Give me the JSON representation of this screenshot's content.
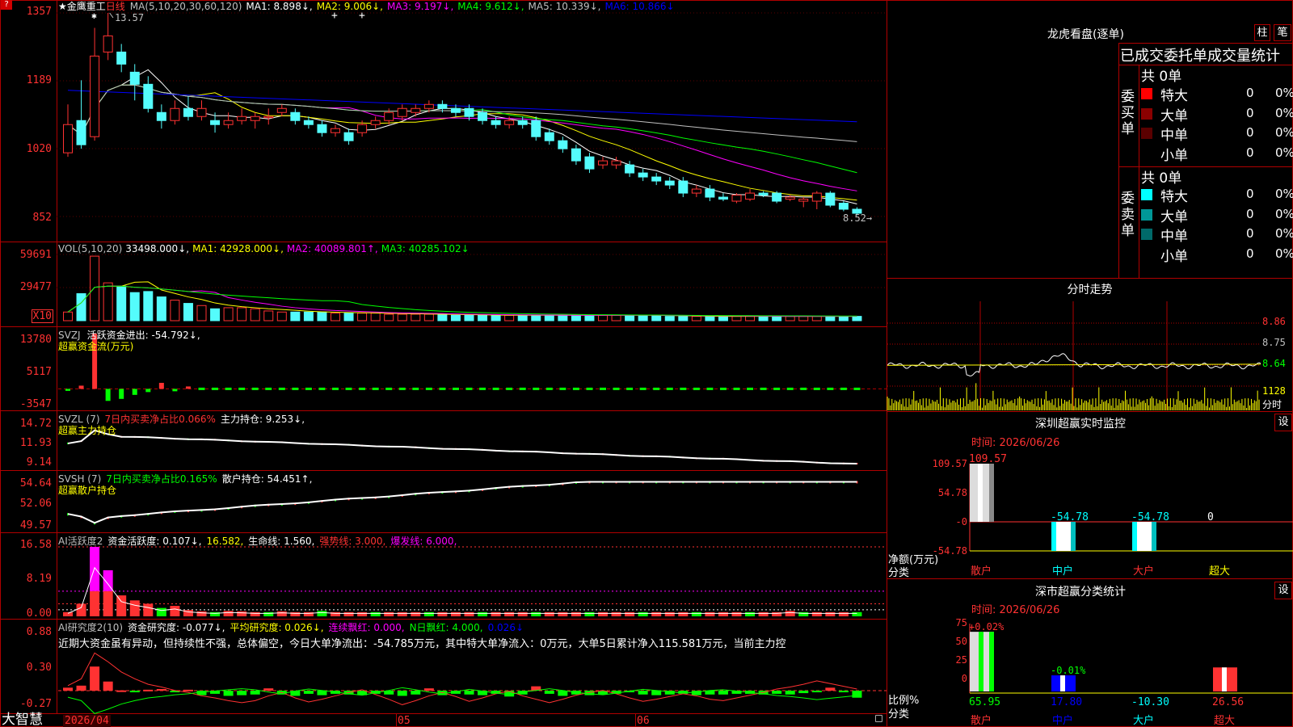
{
  "app": {
    "brand": "大智慧",
    "stock_name": "金鹰重工",
    "period": "日线",
    "marker": "★"
  },
  "colors": {
    "up": "#ff3232",
    "down": "#54fcfc",
    "vol": "#ffff54",
    "grid": "#b00000",
    "bg": "#000000"
  },
  "price_panel": {
    "ma_header": [
      {
        "text": "MA(5,10,20,30,60,120)",
        "color": "#c0c0c0"
      },
      {
        "text": "MA1: 8.898↓,",
        "color": "#ffffff"
      },
      {
        "text": "MA2: 9.006↓,",
        "color": "#ffff00"
      },
      {
        "text": "MA3: 9.197↓,",
        "color": "#ff00ff"
      },
      {
        "text": "MA4: 9.612↓,",
        "color": "#00ff00"
      },
      {
        "text": "MA5: 10.339↓,",
        "color": "#c0c0c0"
      },
      {
        "text": "MA6: 10.866↓",
        "color": "#0000ff"
      }
    ],
    "y_ticks": [
      "1357",
      "1189",
      "1020",
      "852"
    ],
    "high_label": "13.57",
    "low_label": "8.52"
  },
  "vol_panel": {
    "header": [
      {
        "text": "VOL(5,10,20)",
        "color": "#c0c0c0"
      },
      {
        "text": "33498.000↓,",
        "color": "#ffffff"
      },
      {
        "text": "MA1: 42928.000↓,",
        "color": "#ffff00"
      },
      {
        "text": "MA2: 40089.801↑,",
        "color": "#ff00ff"
      },
      {
        "text": "MA3: 40285.102↓",
        "color": "#00ff00"
      }
    ],
    "y_ticks": [
      "59691",
      "29477"
    ],
    "unit": "X10"
  },
  "svzj_panel": {
    "header": [
      {
        "text": "SVZJ",
        "color": "#c0c0c0"
      },
      {
        "text": "活跃资金进出: -54.792↓,",
        "color": "#ffffff"
      }
    ],
    "title": "超赢资金流(万元)",
    "y_ticks": [
      "13780",
      "5117",
      "-3547"
    ]
  },
  "svzl_panel": {
    "header": [
      {
        "text": "SVZL (7)",
        "color": "#c0c0c0"
      },
      {
        "text": "7日内买卖净占比0.066%",
        "color": "#ff3232"
      },
      {
        "text": "主力持仓: 9.253↓,",
        "color": "#ffffff"
      }
    ],
    "title": "超赢主力持仓",
    "y_ticks": [
      "14.72",
      "11.93",
      "9.14"
    ]
  },
  "svsh_panel": {
    "header": [
      {
        "text": "SVSH (7)",
        "color": "#c0c0c0"
      },
      {
        "text": "7日内买卖净占比0.165%",
        "color": "#00ff00"
      },
      {
        "text": "散户持仓: 54.451↑,",
        "color": "#ffffff"
      }
    ],
    "title": "超赢散户持仓",
    "y_ticks": [
      "54.64",
      "52.06",
      "49.57"
    ]
  },
  "ai_panel": {
    "header": [
      {
        "text": "AI活跃度2",
        "color": "#c0c0c0"
      },
      {
        "text": "资金活跃度: 0.107↓,",
        "color": "#ffffff"
      },
      {
        "text": "16.582,",
        "color": "#ffff00"
      },
      {
        "text": "生命线: 1.560,",
        "color": "#ffffff"
      },
      {
        "text": "强势线: 3.000,",
        "color": "#ff3232"
      },
      {
        "text": "爆发线: 6.000,",
        "color": "#ff00ff"
      }
    ],
    "y_ticks": [
      "16.58",
      "8.19",
      "0.00"
    ]
  },
  "air_panel": {
    "header": [
      {
        "text": "AI研究度2(10)",
        "color": "#c0c0c0"
      },
      {
        "text": "资金研究度: -0.077↓,",
        "color": "#ffffff"
      },
      {
        "text": "平均研究度: 0.026↓,",
        "color": "#ffff00"
      },
      {
        "text": "连续飘红: 0.000,",
        "color": "#ff00ff"
      },
      {
        "text": "N日飘红: 4.000,",
        "color": "#00ff00"
      },
      {
        "text": "0.026↓",
        "color": "#0000ff"
      }
    ],
    "comment": "近期大资金虽有异动，但持续性不强，总体偏空，今日大单净流出：-54.785万元，其中特大单净流入：0万元，大单5日累计净入115.581万元，当前主力控",
    "y_ticks": [
      "0.88",
      "0.30",
      "-0.27"
    ]
  },
  "x_axis": {
    "labels": [
      "2026/04",
      "05",
      "06"
    ]
  },
  "longhu": {
    "title": "龙虎看盘(逐单)",
    "btn_zhu": "柱",
    "btn_bi": "笔",
    "stats_title": "已成交委托单成交量统计",
    "buy": {
      "side": "委买单",
      "total": "共 0单",
      "rows": [
        {
          "label": "特大",
          "count": "0",
          "pct": "0%",
          "color": "#ff0000"
        },
        {
          "label": "大单",
          "count": "0",
          "pct": "0%",
          "color": "#8b0000"
        },
        {
          "label": "中单",
          "count": "0",
          "pct": "0%",
          "color": "#5a0000"
        },
        {
          "label": "小单",
          "count": "0",
          "pct": "0%",
          "color": ""
        }
      ]
    },
    "sell": {
      "side": "委卖单",
      "total": "共 0单",
      "rows": [
        {
          "label": "特大",
          "count": "0",
          "pct": "0%",
          "color": "#00ffff"
        },
        {
          "label": "大单",
          "count": "0",
          "pct": "0%",
          "color": "#009898"
        },
        {
          "label": "中单",
          "count": "0",
          "pct": "0%",
          "color": "#006a6a"
        },
        {
          "label": "小单",
          "count": "0",
          "pct": "0%",
          "color": ""
        }
      ]
    }
  },
  "intraday": {
    "title": "分时走势",
    "price_ticks": [
      "8.86",
      "8.75",
      "8.64"
    ],
    "vol_tick": "1128",
    "vol_label": "分时"
  },
  "sz_monitor": {
    "title": "深圳超赢实时监控",
    "settings": "设",
    "time": "时间: 2026/06/26",
    "y_ticks": [
      "109.57",
      "54.78",
      "-0",
      "-54.78"
    ],
    "axis_label_1": "净额(万元)",
    "axis_label_2": "分类"
  },
  "sz_class": {
    "title": "深市超赢分类统计",
    "settings": "设",
    "time": "时间: 2026/06/26",
    "y_ticks": [
      "75",
      "50",
      "25",
      "0"
    ],
    "axis_label_1": "比例%",
    "axis_label_2": "分类"
  },
  "chart_data": [
    {
      "type": "candlestick",
      "title": "金鹰重工 日线",
      "ylim": [
        8.52,
        13.57
      ],
      "candles": [
        [
          10.1,
          10.8,
          10.0,
          11.3
        ],
        [
          10.9,
          10.3,
          10.2,
          11.9
        ],
        [
          10.5,
          12.5,
          10.4,
          13.2
        ],
        [
          12.6,
          13.0,
          12.4,
          13.57
        ],
        [
          12.6,
          12.3,
          12.1,
          12.8
        ],
        [
          12.1,
          11.8,
          11.4,
          12.3
        ],
        [
          11.8,
          11.2,
          11.1,
          12.0
        ],
        [
          11.1,
          10.9,
          10.7,
          11.3
        ],
        [
          10.9,
          11.2,
          10.8,
          11.4
        ],
        [
          11.2,
          11.0,
          10.9,
          11.5
        ],
        [
          11.0,
          11.2,
          10.9,
          11.4
        ],
        [
          10.9,
          10.8,
          10.6,
          11.1
        ],
        [
          10.8,
          10.9,
          10.7,
          11.1
        ],
        [
          10.9,
          11.0,
          10.8,
          11.2
        ],
        [
          10.9,
          11.0,
          10.7,
          11.1
        ],
        [
          11.0,
          11.0,
          10.8,
          11.2
        ],
        [
          11.1,
          11.2,
          11.0,
          11.3
        ],
        [
          11.1,
          10.9,
          10.8,
          11.2
        ],
        [
          10.9,
          10.8,
          10.7,
          11.0
        ],
        [
          10.8,
          10.6,
          10.5,
          10.9
        ],
        [
          10.6,
          10.7,
          10.5,
          10.8
        ],
        [
          10.6,
          10.4,
          10.3,
          10.7
        ],
        [
          10.6,
          10.8,
          10.5,
          10.9
        ],
        [
          10.8,
          10.9,
          10.7,
          11.0
        ],
        [
          10.9,
          11.1,
          10.8,
          11.2
        ],
        [
          11.0,
          11.2,
          10.9,
          11.3
        ],
        [
          11.1,
          11.2,
          11.0,
          11.3
        ],
        [
          11.2,
          11.3,
          11.1,
          11.4
        ],
        [
          11.3,
          11.2,
          11.1,
          11.4
        ],
        [
          11.2,
          11.1,
          11.0,
          11.3
        ],
        [
          11.2,
          11.0,
          10.9,
          11.3
        ],
        [
          11.1,
          10.9,
          10.8,
          11.2
        ],
        [
          10.9,
          10.8,
          10.7,
          11.0
        ],
        [
          10.8,
          10.9,
          10.7,
          11.0
        ],
        [
          10.9,
          10.8,
          10.7,
          11.0
        ],
        [
          10.9,
          10.5,
          10.4,
          11.0
        ],
        [
          10.6,
          10.4,
          10.3,
          10.7
        ],
        [
          10.4,
          10.2,
          10.1,
          10.5
        ],
        [
          10.2,
          9.9,
          9.8,
          10.3
        ],
        [
          10.0,
          9.7,
          9.6,
          10.1
        ],
        [
          9.8,
          9.9,
          9.7,
          10.0
        ],
        [
          9.8,
          9.9,
          9.7,
          10.0
        ],
        [
          9.8,
          9.6,
          9.5,
          9.9
        ],
        [
          9.6,
          9.5,
          9.4,
          9.7
        ],
        [
          9.5,
          9.4,
          9.3,
          9.6
        ],
        [
          9.4,
          9.3,
          9.2,
          9.5
        ],
        [
          9.4,
          9.1,
          9.0,
          9.5
        ],
        [
          9.1,
          9.2,
          9.0,
          9.3
        ],
        [
          9.2,
          9.0,
          8.9,
          9.3
        ],
        [
          9.0,
          8.95,
          8.9,
          9.1
        ],
        [
          8.9,
          9.05,
          8.85,
          9.1
        ],
        [
          8.95,
          9.1,
          8.9,
          9.2
        ],
        [
          9.1,
          9.05,
          9.0,
          9.15
        ],
        [
          9.1,
          8.9,
          8.85,
          9.15
        ],
        [
          8.95,
          9.0,
          8.9,
          9.05
        ],
        [
          8.9,
          8.95,
          8.75,
          9.0
        ],
        [
          8.9,
          9.1,
          8.7,
          9.15
        ],
        [
          9.1,
          8.8,
          8.75,
          9.15
        ],
        [
          8.85,
          8.7,
          8.65,
          8.9
        ],
        [
          8.7,
          8.6,
          8.55,
          8.75
        ]
      ]
    },
    {
      "type": "bar",
      "title": "VOL(5,10,20)",
      "ylim": [
        0,
        65000
      ],
      "values": [
        8000,
        25000,
        59691,
        35000,
        32000,
        26000,
        27000,
        22000,
        19000,
        16000,
        14000,
        11000,
        12000,
        12000,
        11000,
        9000,
        8000,
        8000,
        8000,
        8000,
        7000,
        7000,
        7000,
        7000,
        6000,
        6000,
        6000,
        6000,
        6000,
        5000,
        5000,
        5000,
        5000,
        5000,
        5000,
        5000,
        5000,
        5000,
        5000,
        5000,
        5000,
        5000,
        5000,
        5000,
        5000,
        4000,
        4000,
        4000,
        4000,
        4000,
        4000,
        4000,
        4000,
        4000,
        4000,
        4000,
        4000,
        4000,
        4000,
        4000
      ]
    },
    {
      "type": "bar",
      "title": "超赢资金流(万元)",
      "ylim": [
        -3547,
        13780
      ],
      "values": [
        -500,
        800,
        13780,
        -3000,
        -2500,
        -1500,
        -800,
        1500,
        -600,
        600,
        -400,
        -300,
        -300,
        -300,
        -300,
        -300,
        -300,
        -300,
        -300,
        -300,
        -300,
        -300,
        -300,
        -300,
        -300,
        -300,
        -300,
        -300,
        -300,
        -300,
        -300,
        -300,
        -300,
        -300,
        -300,
        -300,
        -300,
        -300,
        -300,
        -300,
        -300,
        -300,
        -300,
        -300,
        -300,
        -300,
        -300,
        -300,
        -300,
        -300,
        -300,
        -300,
        -300,
        -300,
        -300,
        -300,
        -300,
        -300,
        -300,
        -300
      ]
    },
    {
      "type": "bar",
      "title": "深圳超赢实时监控",
      "categories": [
        "散户",
        "中户",
        "大户",
        "超大"
      ],
      "values": [
        109.57,
        -54.78,
        -54.78,
        0
      ],
      "ylim": [
        -54.78,
        109.57
      ],
      "data_labels": [
        "109.57",
        "-54.78",
        "-54.78",
        "0"
      ]
    },
    {
      "type": "bar",
      "title": "深市超赢分类统计",
      "categories": [
        "散户",
        "中户",
        "大户",
        "超大"
      ],
      "values": [
        65.95,
        17.8,
        -10.3,
        26.56
      ],
      "top_labels": [
        "+0.02%",
        "-0.01%",
        "",
        ""
      ],
      "ylim": [
        0,
        75
      ]
    }
  ]
}
